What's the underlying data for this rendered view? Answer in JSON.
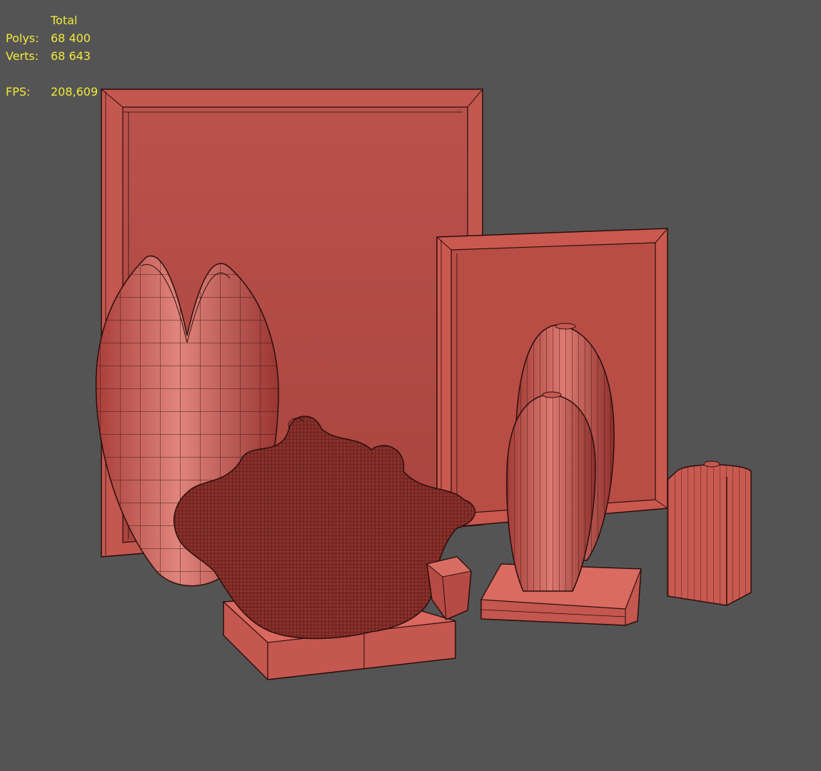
{
  "stats": {
    "header": "Total",
    "rows": [
      {
        "label": "Polys:",
        "value": "68 400"
      },
      {
        "label": "Verts:",
        "value": "68 643"
      }
    ],
    "fps": {
      "label": "FPS:",
      "value": "208,609"
    }
  },
  "colors": {
    "background": "#545454",
    "model": "#c45750",
    "wire": "#2a0e0c",
    "stats_text": "#f2ea3a"
  },
  "scene_objects": [
    "large-picture-frame",
    "small-picture-frame",
    "tall-pinched-vase",
    "coral-sculpture",
    "tall-vase",
    "short-vase",
    "square-vase",
    "small-geometric-vase"
  ]
}
